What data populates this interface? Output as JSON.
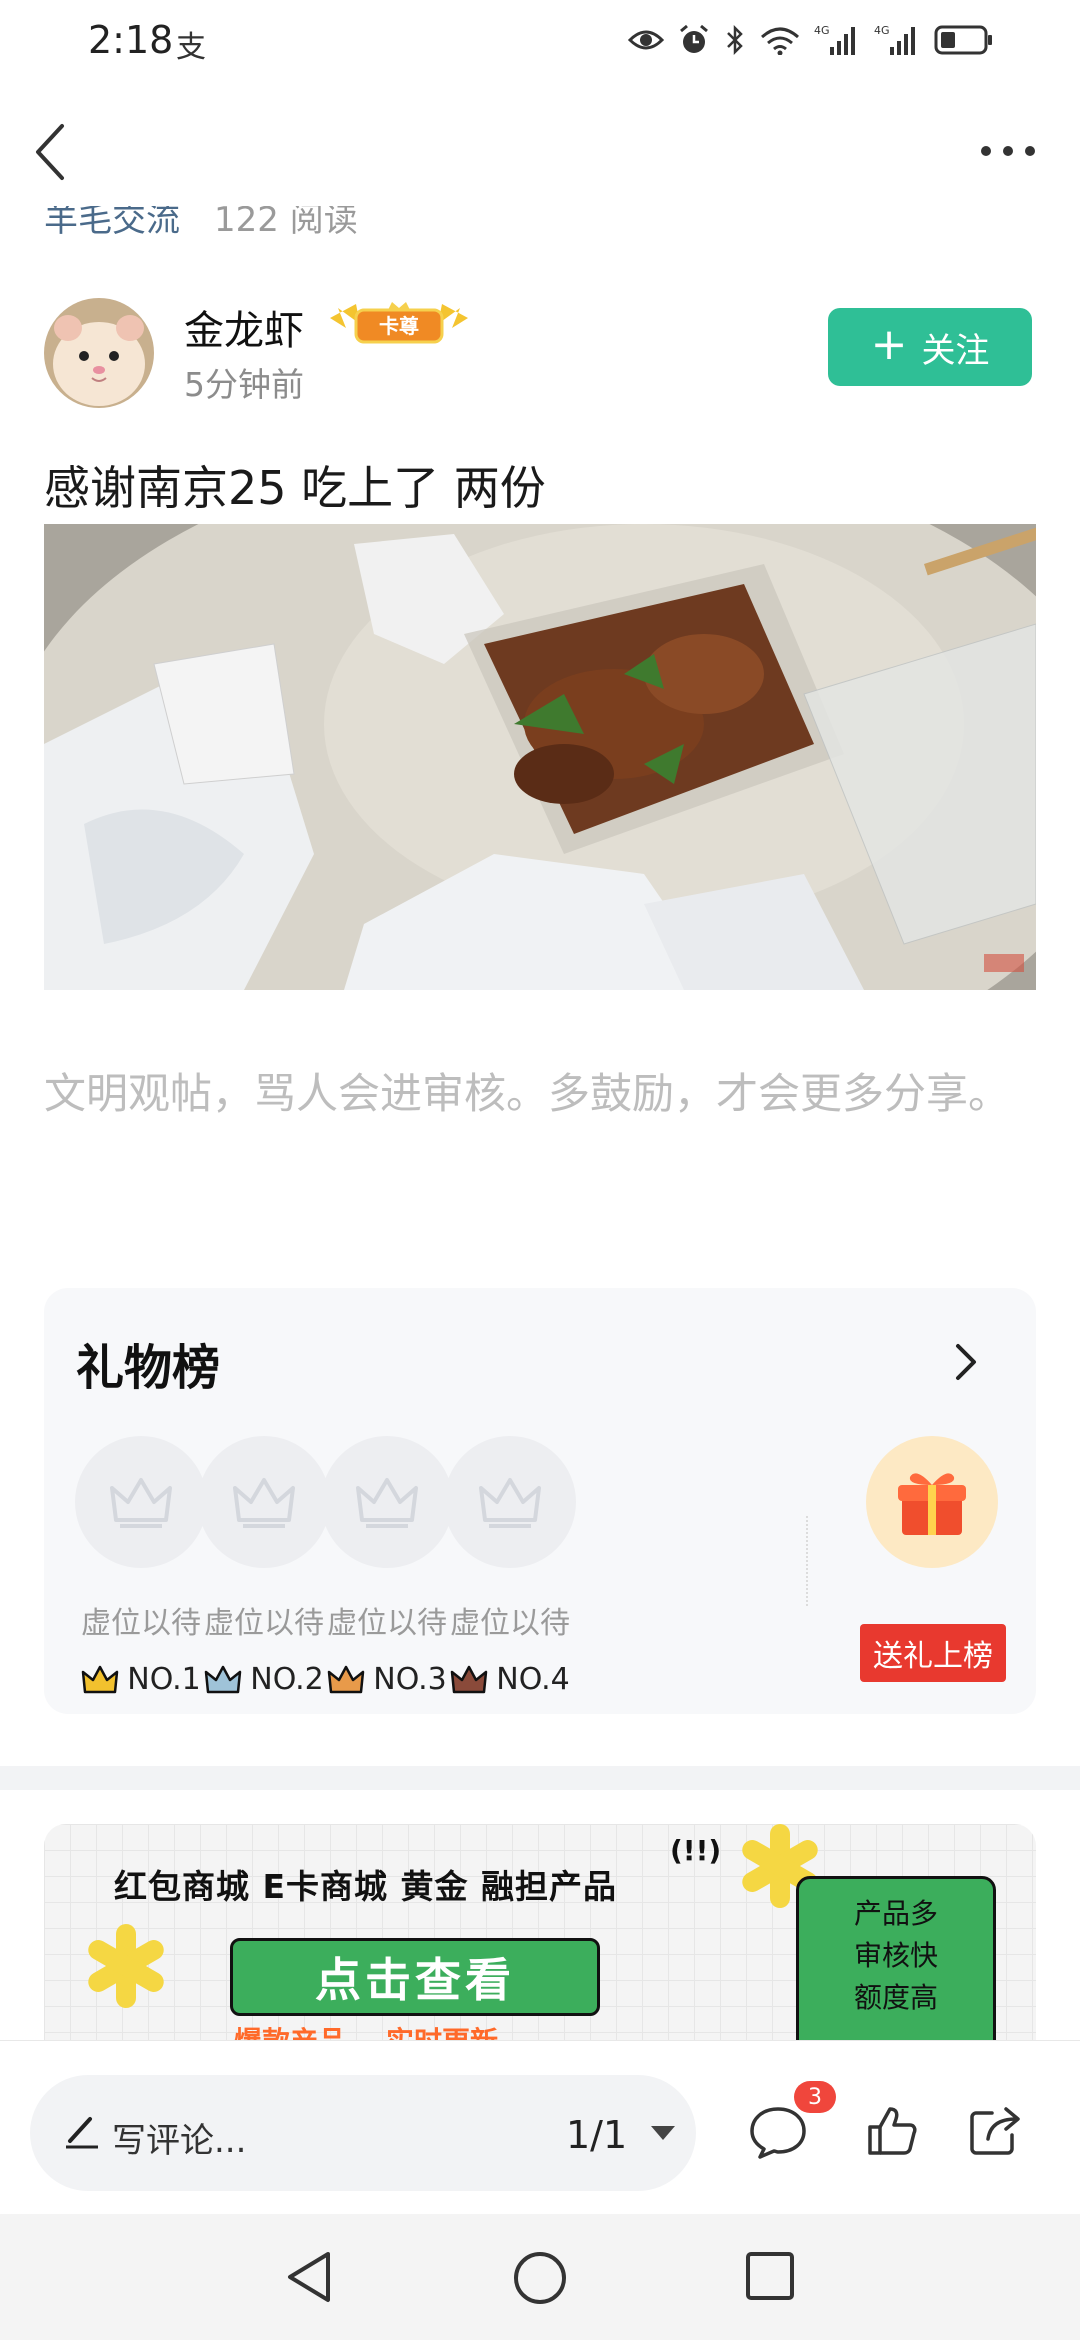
{
  "status_bar": {
    "time": "2:18",
    "left_app_icon": "支",
    "icons": [
      "eye-icon",
      "alarm-icon",
      "bluetooth-icon",
      "wifi-icon",
      "signal-4g-icon",
      "signal-4g-icon",
      "battery-icon"
    ],
    "network_1": "4G",
    "network_2": "4G"
  },
  "nav": {
    "back_icon": "chevron-left-icon",
    "more_icon": "more-dots-icon"
  },
  "forum": {
    "name": "羊毛交流",
    "reads": "122 阅读"
  },
  "author": {
    "name": "金龙虾",
    "badge": "卡尊",
    "time": "5分钟前",
    "follow_label": "关注",
    "follow_plus": "+"
  },
  "post": {
    "title": "感谢南京25 吃上了 两份"
  },
  "notice": "文明观帖，骂人会进审核。多鼓励，才会更多分享。",
  "gift_board": {
    "title": "礼物榜",
    "ranks": [
      {
        "label": "虚位以待",
        "no": "NO.1",
        "crown_color": "#f2c12e"
      },
      {
        "label": "虚位以待",
        "no": "NO.2",
        "crown_color": "#9fc3d8"
      },
      {
        "label": "虚位以待",
        "no": "NO.3",
        "crown_color": "#e89a4a"
      },
      {
        "label": "虚位以待",
        "no": "NO.4",
        "crown_color": "#8a4a3a"
      }
    ],
    "send_label": "送礼上榜"
  },
  "banner": {
    "categories": "红包商城  E卡商城  黄金  融担产品",
    "exclaim": "(!!)",
    "cta": "点击查看",
    "sub_1": "爆款产品",
    "sub_2": "实时更新",
    "features": [
      "产品多",
      "审核快",
      "额度高"
    ]
  },
  "bottom_bar": {
    "comment_placeholder": "写评论...",
    "page_indicator": "1/1",
    "comment_count": "3"
  },
  "colors": {
    "follow_green": "#2fbf96",
    "send_red": "#e8392f",
    "banner_green": "#3cae5c"
  }
}
